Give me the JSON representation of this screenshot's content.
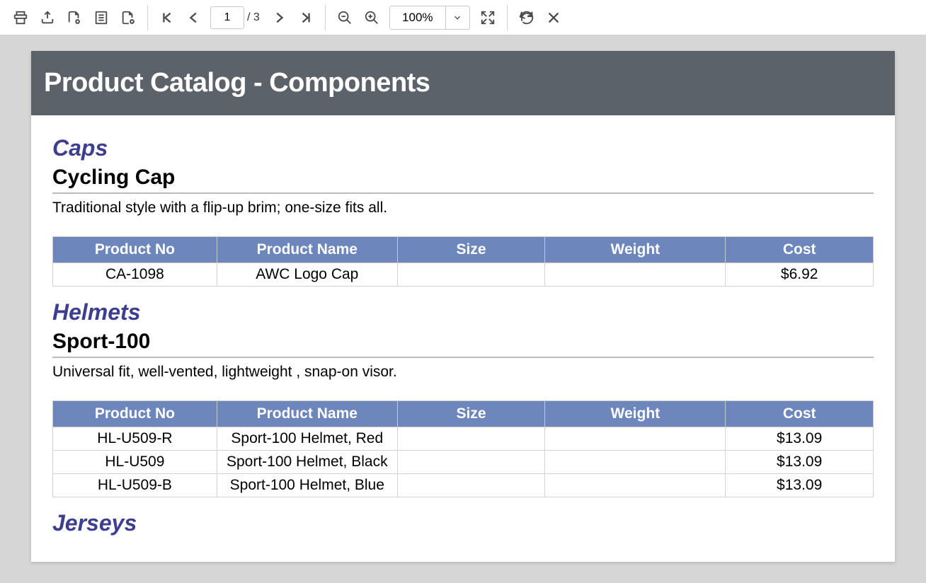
{
  "toolbar": {
    "page_current": "1",
    "page_total": "/ 3",
    "zoom_value": "100%"
  },
  "report": {
    "title": "Product Catalog - Components",
    "columns": {
      "no": "Product No",
      "name": "Product Name",
      "size": "Size",
      "weight": "Weight",
      "cost": "Cost"
    },
    "sections": [
      {
        "category": "Caps",
        "model": "Cycling Cap",
        "desc": "Traditional style with a flip-up brim; one-size fits all.",
        "rows": [
          {
            "no": "CA-1098",
            "name": "AWC Logo Cap",
            "size": "",
            "weight": "",
            "cost": "$6.92"
          }
        ]
      },
      {
        "category": "Helmets",
        "model": "Sport-100",
        "desc": "Universal fit, well-vented, lightweight , snap-on visor.",
        "rows": [
          {
            "no": "HL-U509-R",
            "name": "Sport-100 Helmet, Red",
            "size": "",
            "weight": "",
            "cost": "$13.09"
          },
          {
            "no": "HL-U509",
            "name": "Sport-100 Helmet, Black",
            "size": "",
            "weight": "",
            "cost": "$13.09"
          },
          {
            "no": "HL-U509-B",
            "name": "Sport-100 Helmet, Blue",
            "size": "",
            "weight": "",
            "cost": "$13.09"
          }
        ]
      },
      {
        "category": "Jerseys",
        "model": "",
        "desc": "",
        "rows": []
      }
    ]
  }
}
